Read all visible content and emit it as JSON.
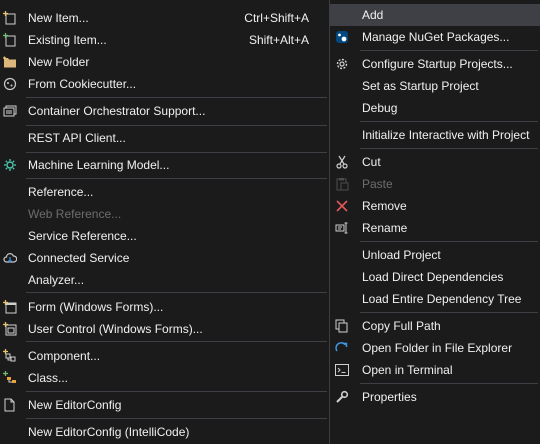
{
  "left_menu": {
    "items": [
      {
        "label": "New Item...",
        "shortcut": "Ctrl+Shift+A"
      },
      {
        "label": "Existing Item...",
        "shortcut": "Shift+Alt+A"
      },
      {
        "label": "New Folder"
      },
      {
        "label": "From Cookiecutter..."
      },
      {
        "label": "Container Orchestrator Support..."
      },
      {
        "label": "REST API Client..."
      },
      {
        "label": "Machine Learning Model..."
      },
      {
        "label": "Reference..."
      },
      {
        "label": "Web Reference...",
        "disabled": true
      },
      {
        "label": "Service Reference..."
      },
      {
        "label": "Connected Service"
      },
      {
        "label": "Analyzer..."
      },
      {
        "label": "Form (Windows Forms)..."
      },
      {
        "label": "User Control (Windows Forms)..."
      },
      {
        "label": "Component..."
      },
      {
        "label": "Class..."
      },
      {
        "label": "New EditorConfig"
      },
      {
        "label": "New EditorConfig (IntelliCode)"
      }
    ]
  },
  "right_menu": {
    "items": [
      {
        "label": "Add",
        "highlighted": true
      },
      {
        "label": "Manage NuGet Packages..."
      },
      {
        "label": "Configure Startup Projects..."
      },
      {
        "label": "Set as Startup Project"
      },
      {
        "label": "Debug"
      },
      {
        "label": "Initialize Interactive with Project"
      },
      {
        "label": "Cut"
      },
      {
        "label": "Paste",
        "disabled": true
      },
      {
        "label": "Remove"
      },
      {
        "label": "Rename"
      },
      {
        "label": "Unload Project"
      },
      {
        "label": "Load Direct Dependencies"
      },
      {
        "label": "Load Entire Dependency Tree"
      },
      {
        "label": "Copy Full Path"
      },
      {
        "label": "Open Folder in File Explorer"
      },
      {
        "label": "Open in Terminal"
      },
      {
        "label": "Properties"
      }
    ]
  },
  "icons": {
    "new_item": "new-item-icon",
    "existing_item": "existing-item-icon",
    "new_folder": "folder-icon",
    "cookiecutter": "cookiecutter-icon",
    "container": "container-icon",
    "ml_model": "ml-model-icon",
    "connected_service": "cloud-icon",
    "form": "form-icon",
    "user_control": "user-control-icon",
    "component": "component-icon",
    "class": "class-icon",
    "editorconfig": "document-icon",
    "nuget": "nuget-icon",
    "configure": "gear-icon",
    "cut": "scissors-icon",
    "paste": "paste-icon",
    "remove": "close-icon",
    "rename": "rename-icon",
    "copy_path": "copy-icon",
    "open_folder": "refresh-arrow-icon",
    "terminal": "terminal-icon",
    "properties": "wrench-icon"
  },
  "colors": {
    "background": "#1b1b1c",
    "highlight": "#3f3f46",
    "separator": "#3f3f46",
    "text": "#f1f1f1",
    "disabled_text": "#6d6d6d",
    "accent_blue": "#3d9ae8",
    "remove_red": "#e05757"
  }
}
